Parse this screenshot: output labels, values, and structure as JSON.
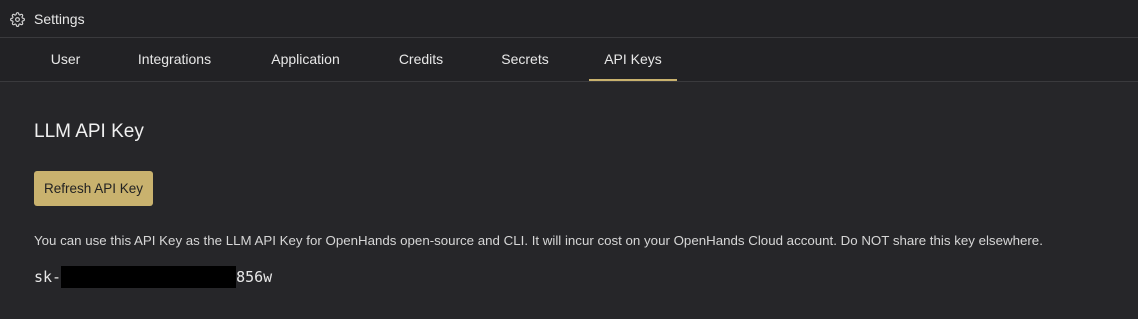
{
  "window": {
    "title": "Settings",
    "icon": "gear-icon"
  },
  "tabs": [
    {
      "label": "User"
    },
    {
      "label": "Integrations"
    },
    {
      "label": "Application"
    },
    {
      "label": "Credits"
    },
    {
      "label": "Secrets"
    },
    {
      "label": "API Keys",
      "active": true
    }
  ],
  "section": {
    "title": "LLM API Key",
    "refresh_button_label": "Refresh API Key",
    "description": "You can use this API Key as the LLM API Key for OpenHands open-source and CLI. It will incur cost on your OpenHands Cloud account. Do NOT share this key elsewhere.",
    "key_prefix": "sk-",
    "key_suffix": "856w"
  },
  "colors": {
    "accent": "#c9b26e",
    "background": "#262629",
    "header_background": "#222225"
  }
}
